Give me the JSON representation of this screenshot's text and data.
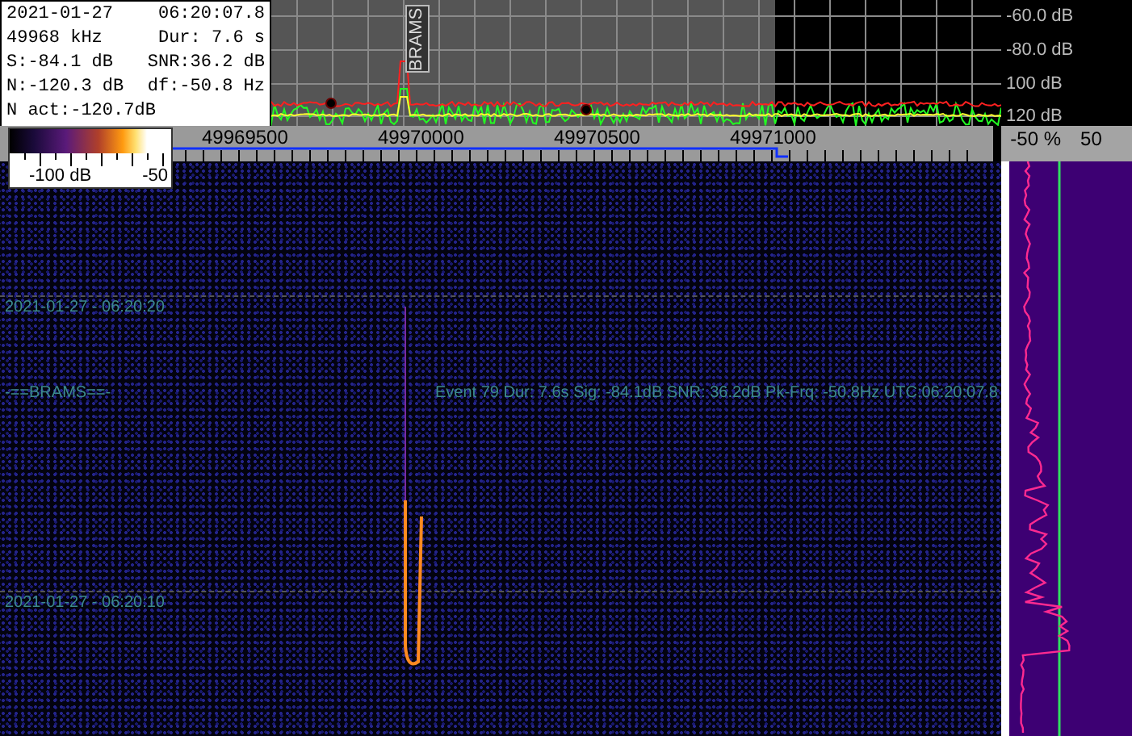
{
  "info_box": {
    "lines": [
      {
        "left": "2021-01-27",
        "right": "06:20:07.8"
      },
      {
        "left": "49968 kHz",
        "right": "Dur: 7.6 s"
      },
      {
        "left": "S:-84.1 dB",
        "right": "SNR:36.2 dB"
      },
      {
        "left": "N:-120.3 dB",
        "right": "df:-50.8 Hz"
      },
      {
        "left": "N act:-120.7dB"
      }
    ]
  },
  "spectrum": {
    "marker_label": "BRAMS",
    "db_labels": [
      "-60.0 dB",
      "-80.0 dB",
      "100 dB",
      "120 dB"
    ]
  },
  "colorbar": {
    "labels": [
      "-100 dB",
      "-50"
    ]
  },
  "frequency_axis": {
    "labels": [
      "49969500",
      "49970000",
      "49970500",
      "49971000"
    ]
  },
  "level_axis": {
    "labels": [
      "-50 %",
      "50"
    ]
  },
  "waterfall": {
    "time_labels": [
      "2021-01-27 - 06:20:20",
      "2021-01-27 - 06:20:10"
    ],
    "station_label": "-==BRAMS==-",
    "event_text": "Event 79  Dur: 7.6s  Sig: -84.1dB  SNR: 36.2dB  Pk-Frq: -50.8Hz  UTC:06:20:07.8"
  }
}
